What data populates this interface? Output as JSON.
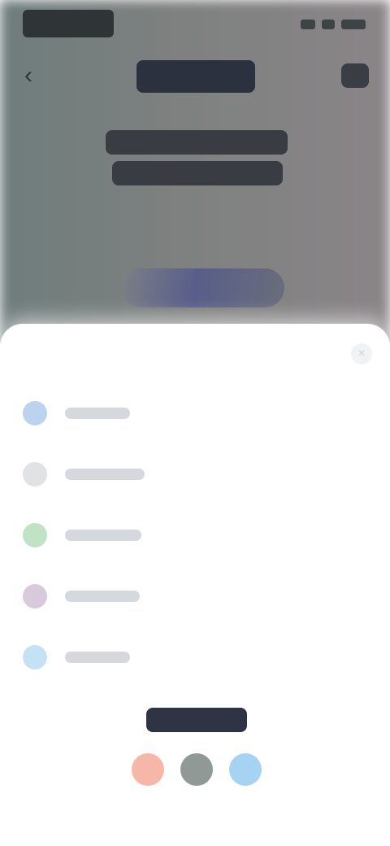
{
  "status_bar": {
    "time": "",
    "icons": [
      "signal-icon",
      "wifi-icon",
      "battery-icon"
    ]
  },
  "nav": {
    "back_icon": "back-arrow-icon",
    "title": "",
    "more_icon": "more-icon"
  },
  "hero": {
    "headline_line1": "",
    "headline_line2": "",
    "cta_label": ""
  },
  "sheet": {
    "close_icon": "close-icon",
    "options": [
      {
        "label": "",
        "icon": "blue-circle-icon",
        "color": "#bcd3f0"
      },
      {
        "label": "",
        "icon": "grey-circle-icon",
        "color": "#e0e2e4"
      },
      {
        "label": "",
        "icon": "green-circle-icon",
        "color": "#bfe3c4"
      },
      {
        "label": "",
        "icon": "purple-circle-icon",
        "color": "#d9c9dc"
      },
      {
        "label": "",
        "icon": "lightblue-circle-icon",
        "color": "#c4e2f4"
      }
    ],
    "brand": "",
    "social": [
      {
        "icon": "red-social-icon",
        "color": "#f6b6a8"
      },
      {
        "icon": "dark-social-icon",
        "color": "#8f9a96"
      },
      {
        "icon": "blue-social-icon",
        "color": "#a7d3f3"
      }
    ]
  },
  "colors": {
    "sheet_background": "#ffffff",
    "page_tint": "#7f8180"
  }
}
